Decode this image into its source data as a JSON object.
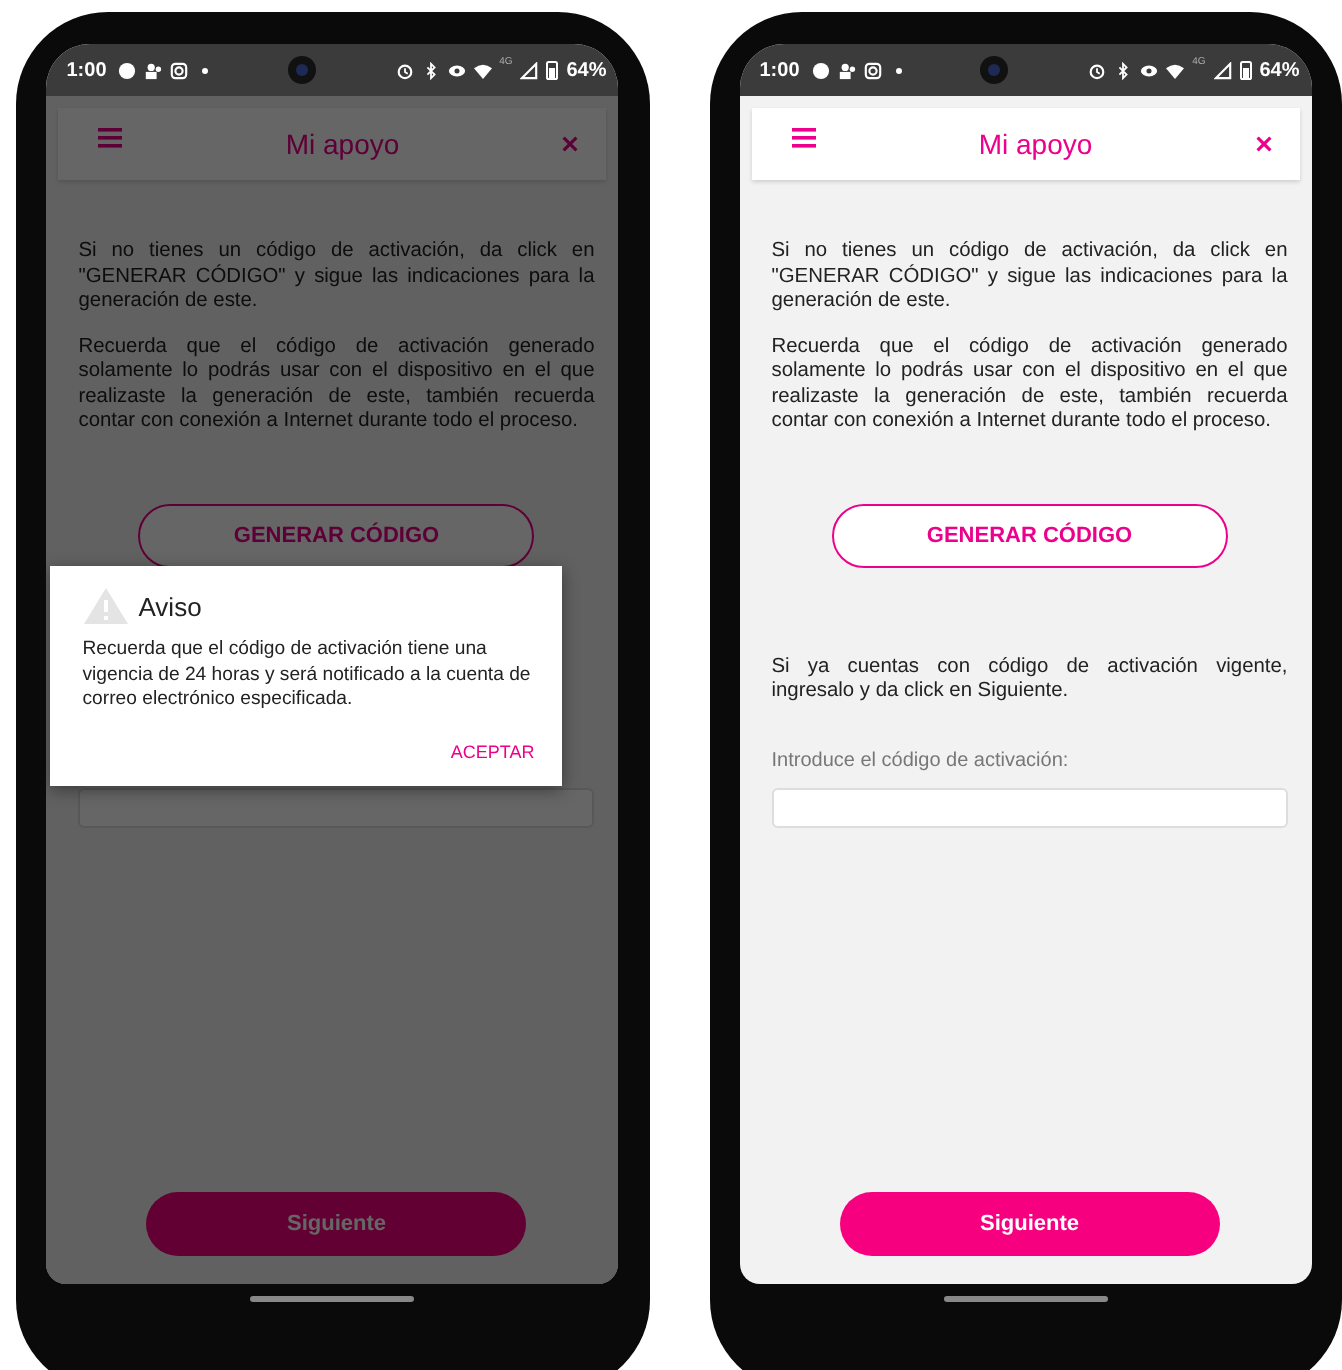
{
  "phones": [
    {
      "status_bar": {
        "time": "1:00",
        "network": "4G",
        "battery": "64%"
      },
      "dimmed": true,
      "header": {
        "title": "Mi apoyo"
      },
      "paragraphs": [
        "Si no tienes un código de activación, da click en \"GENERAR CÓDIGO\" y sigue las indicaciones para la generación de este.",
        "Recuerda que el código de activación generado solamente lo podrás usar con el dispositivo en el que realizaste la generación de este, también recuerda contar con conexión a Internet durante todo el proceso."
      ],
      "generate_button": "GENERAR CÓDIGO",
      "next_button": "Siguiente",
      "dialog": {
        "title": "Aviso",
        "message": "Recuerda que el código de activación tiene una vigencia de 24 horas y será notificado a la cuenta de correo electrónico especificada.",
        "action": "ACEPTAR"
      }
    },
    {
      "status_bar": {
        "time": "1:00",
        "network": "4G",
        "battery": "64%"
      },
      "dimmed": false,
      "header": {
        "title": "Mi apoyo"
      },
      "paragraphs": [
        "Si no tienes un código de activación, da click en \"GENERAR CÓDIGO\" y sigue las indicaciones para la generación de este.",
        "Recuerda que el código de activación generado solamente lo podrás usar con el dispositivo en el que realizaste la generación de este, también recuerda contar con conexión a Internet durante todo el proceso."
      ],
      "generate_button": "GENERAR CÓDIGO",
      "existing_code_text": "Si ya cuentas con código de activación vigente, ingresalo y da click en Siguiente.",
      "input_label": "Introduce el código de activación:",
      "next_button": "Siguiente"
    }
  ]
}
